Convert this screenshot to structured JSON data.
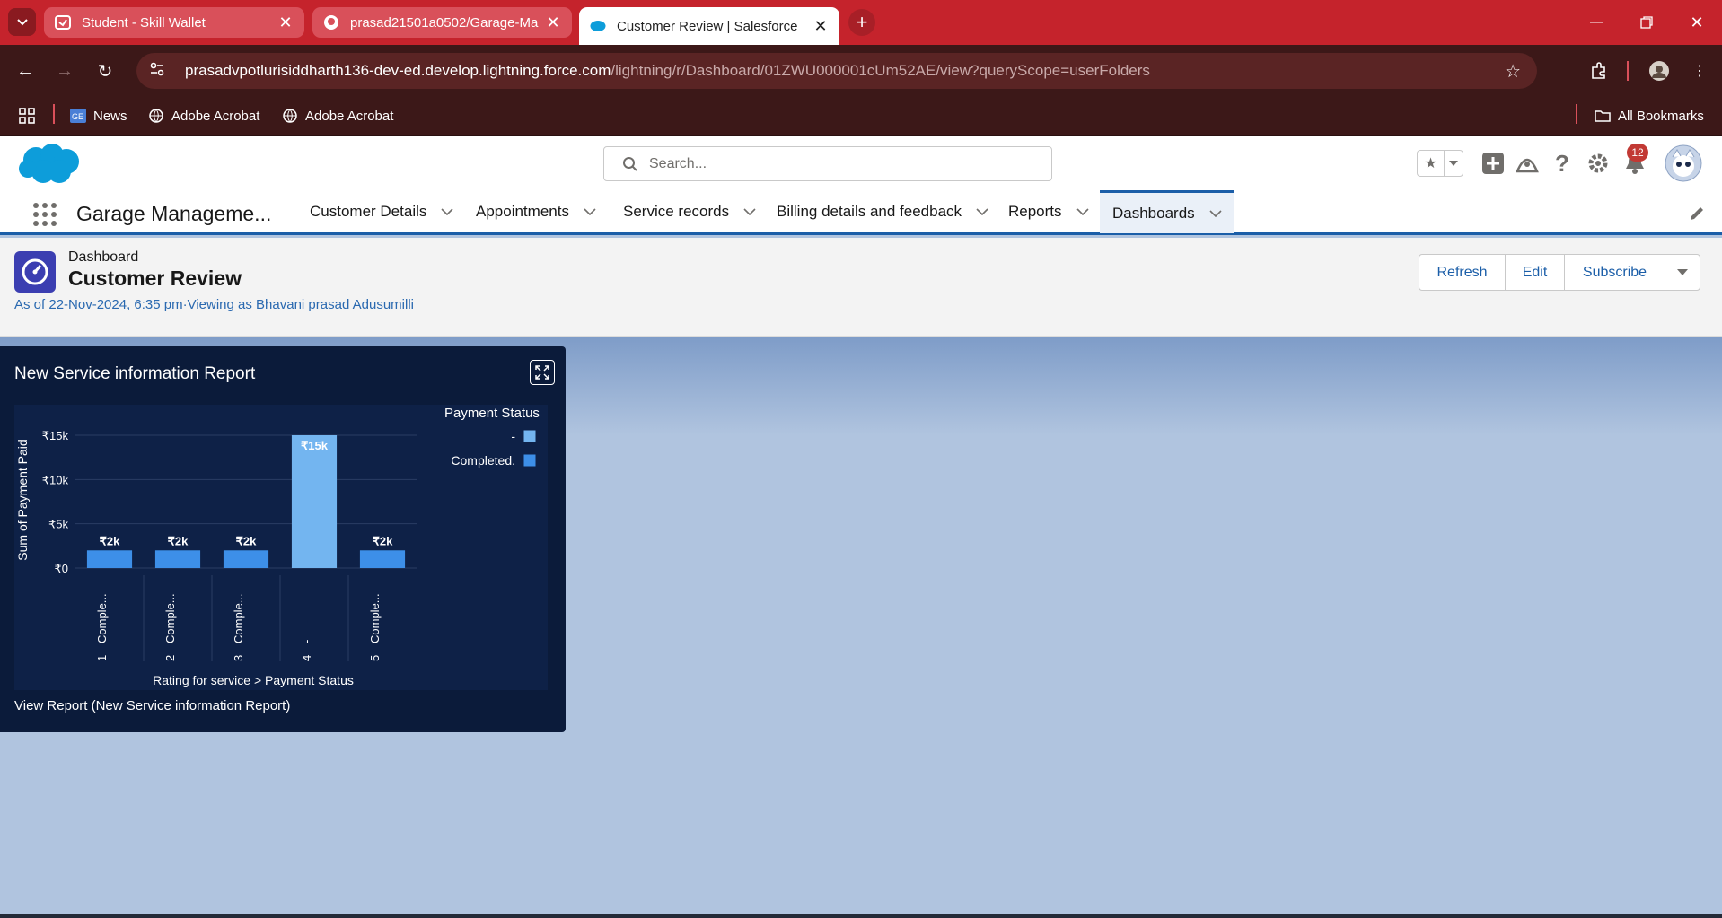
{
  "browser": {
    "tabs": [
      {
        "title": "Student - Skill Wallet",
        "active": false
      },
      {
        "title": "prasad21501a0502/Garage-Ma",
        "active": false
      },
      {
        "title": "Customer Review | Salesforce",
        "active": true
      }
    ],
    "url_host": "prasadvpotlurisiddharth136-dev-ed.develop.lightning.force.com",
    "url_path": "/lightning/r/Dashboard/01ZWU000001cUm52AE/view?queryScope=userFolders",
    "bookmarks": [
      "News",
      "Adobe Acrobat",
      "Adobe Acrobat"
    ],
    "all_bookmarks": "All Bookmarks",
    "colors": {
      "tabstrip": "#c5232c",
      "toolbar": "#3c1818"
    }
  },
  "sf": {
    "search_placeholder": "Search...",
    "notification_count": "12",
    "app_name": "Garage Manageme...",
    "nav": [
      {
        "label": "Customer Details"
      },
      {
        "label": "Appointments"
      },
      {
        "label": "Service records"
      },
      {
        "label": "Billing details and feedback"
      },
      {
        "label": "Reports"
      },
      {
        "label": "Dashboards",
        "active": true
      }
    ],
    "accent": "#1b5ea8"
  },
  "dashboard": {
    "kind": "Dashboard",
    "title": "Customer Review",
    "as_of": "As of 22-Nov-2024, 6:35 pm",
    "viewing_as": "Viewing as Bhavani prasad Adusumilli",
    "buttons": {
      "refresh": "Refresh",
      "edit": "Edit",
      "subscribe": "Subscribe"
    }
  },
  "widget": {
    "title": "New Service information Report",
    "link": "View Report (New Service information Report)"
  },
  "chart_data": {
    "type": "bar",
    "ylabel": "Sum of Payment Paid",
    "xlabel": "Rating for service  >  Payment Status",
    "legend_title": "Payment Status",
    "legend_position": "right",
    "ylim": [
      0,
      15000
    ],
    "y_ticks": [
      "₹0",
      "₹5k",
      "₹10k",
      "₹15k"
    ],
    "categories": [
      "1",
      "2",
      "3",
      "4",
      "5"
    ],
    "category_sublabels": [
      "Comple...",
      "Comple...",
      "Comple...",
      "-",
      "Comple..."
    ],
    "series": [
      {
        "name": "-",
        "color": "#73b5f0",
        "values": [
          0,
          0,
          0,
          15000,
          0
        ]
      },
      {
        "name": "Completed.",
        "color": "#3d8fe8",
        "values": [
          2000,
          2000,
          2000,
          0,
          2000
        ]
      }
    ],
    "data_labels": [
      "₹2k",
      "₹2k",
      "₹2k",
      "₹15k",
      "₹2k"
    ]
  }
}
